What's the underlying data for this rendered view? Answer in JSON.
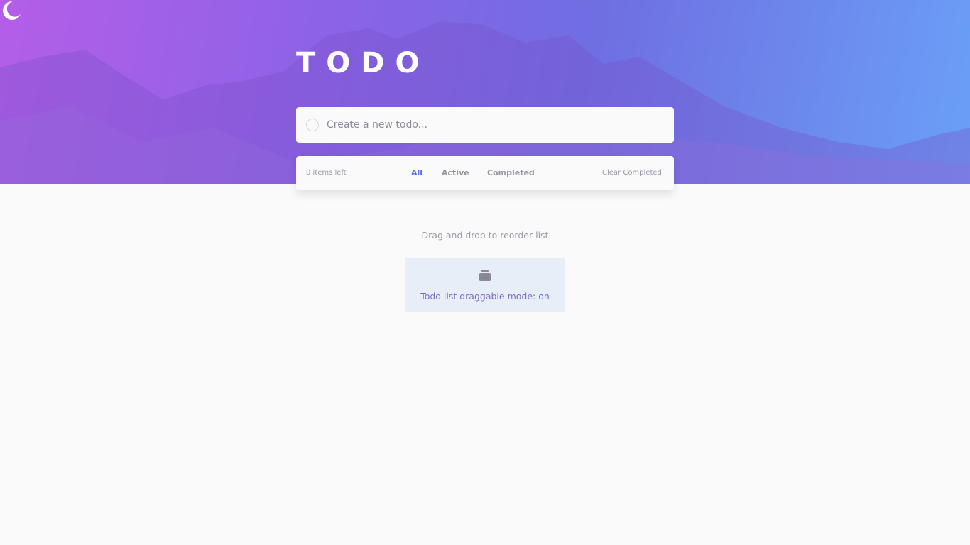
{
  "header": {
    "title": "TODO",
    "theme_toggle_icon": "moon-icon"
  },
  "new_todo": {
    "placeholder": "Create a new todo..."
  },
  "footer": {
    "items_left": "0 items left",
    "filters": [
      "All",
      "Active",
      "Completed"
    ],
    "active_filter": "All",
    "clear_label": "Clear Completed"
  },
  "hint": "Drag and drop to reorder list",
  "drag_mode": {
    "label": "Todo list draggable mode:",
    "value": "on",
    "icon": "inbox-tray-icon"
  },
  "colors": {
    "accent": "#5a6ee6",
    "gradient_start": "#b45ee9",
    "gradient_end": "#6aa0f7"
  }
}
